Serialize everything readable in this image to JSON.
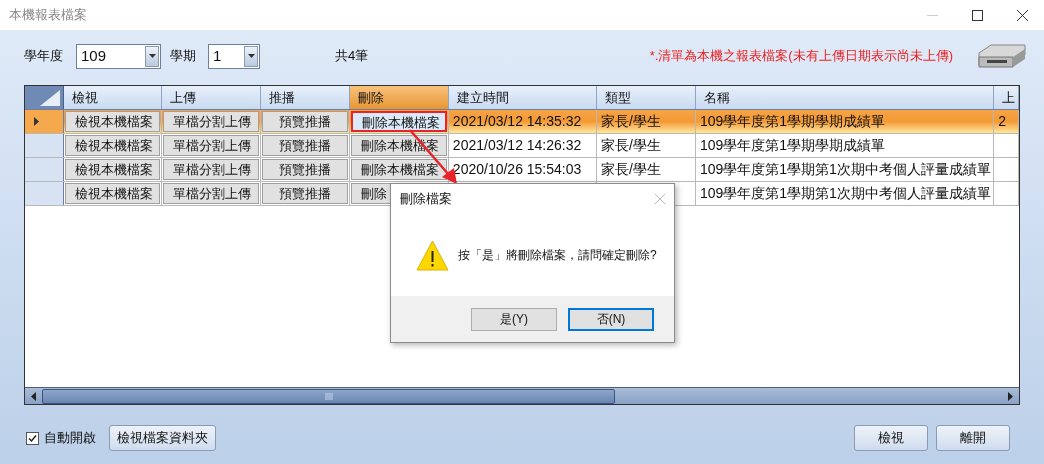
{
  "window": {
    "title": "本機報表檔案"
  },
  "filters": [
    {
      "label": "學年度",
      "value": "109"
    },
    {
      "label": "學期",
      "value": "1"
    }
  ],
  "count": "共4筆",
  "notice": "*.清單為本機之報表檔案(未有上傳日期表示尚未上傳)",
  "table": {
    "columns": [
      {
        "label": "檢視",
        "kind": "button",
        "selected": false
      },
      {
        "label": "上傳",
        "kind": "button",
        "selected": false
      },
      {
        "label": "推播",
        "kind": "button",
        "selected": false
      },
      {
        "label": "刪除",
        "kind": "button",
        "selected": true
      },
      {
        "label": "建立時間",
        "kind": "text",
        "selected": false
      },
      {
        "label": "類型",
        "kind": "text",
        "selected": false
      },
      {
        "label": "名稱",
        "kind": "text",
        "selected": false
      },
      {
        "label": "上",
        "kind": "text",
        "selected": false
      }
    ],
    "rows": [
      {
        "selected": true,
        "marked": true,
        "cells": [
          "檢視本機檔案",
          "單檔分割上傳",
          "預覽推播",
          "刪除本機檔案",
          "2021/03/12 14:35:32",
          "家長/學生",
          "109學年度第1學期學期成績單",
          "2"
        ]
      },
      {
        "selected": false,
        "marked": false,
        "cells": [
          "檢視本機檔案",
          "單檔分割上傳",
          "預覽推播",
          "刪除本機檔案",
          "2021/03/12 14:26:32",
          "家長/學生",
          "109學年度第1學期學期成績單",
          null
        ]
      },
      {
        "selected": false,
        "marked": false,
        "cells": [
          "檢視本機檔案",
          "單檔分割上傳",
          "預覽推播",
          "刪除本機檔案",
          "2020/10/26 15:54:03",
          "家長/學生",
          "109學年度第1學期第1次期中考個人評量成績單",
          null
        ]
      },
      {
        "selected": false,
        "marked": false,
        "cells": [
          "檢視本機檔案",
          "單檔分割上傳",
          "預覽推播",
          "刪除",
          null,
          null,
          "109學年度第1學期第1次期中考個人評量成績單",
          null
        ]
      }
    ]
  },
  "auto_open": {
    "label": "自動開啟",
    "checked": true
  },
  "folder_button": "檢視檔案資料夾",
  "footer_buttons": [
    "檢視",
    "離開"
  ],
  "dialog": {
    "title": "刪除檔案",
    "message": "按「是」將刪除檔案，請問確定刪除?",
    "buttons": [
      {
        "label": "是(Y)",
        "focused": false
      },
      {
        "label": "否(N)",
        "focused": true
      }
    ]
  }
}
